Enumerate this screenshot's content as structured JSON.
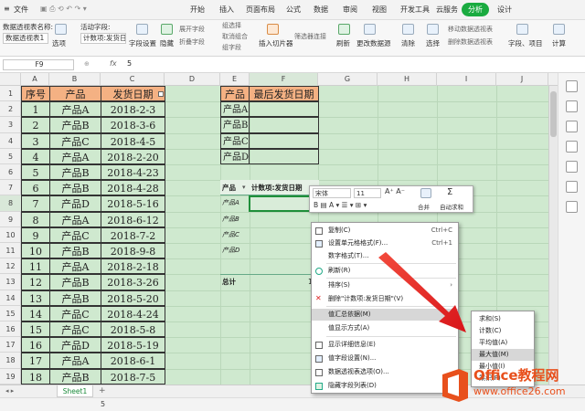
{
  "menubar": {
    "file": "文件",
    "tabs": [
      "开始",
      "插入",
      "页面布局",
      "公式",
      "数据",
      "审阅",
      "视图",
      "开发工具",
      "云服务",
      "分析",
      "设计"
    ],
    "active_tab": "分析"
  },
  "ribbon": {
    "pivot_name_label": "数据透视表名称:",
    "pivot_name_value": "数据透视表1",
    "options_label": "选项",
    "active_field_label": "活动字段:",
    "active_field_value": "计数项:发货日期",
    "field_settings": "字段设置",
    "hide": "隐藏",
    "expand_field": "展开字段",
    "collapse_field": "折叠字段",
    "group_select": "组选择",
    "ungroup": "取消组合",
    "group_field": "组字段",
    "insert_slicer": "插入切片器",
    "filter_conn": "筛选器连接",
    "refresh": "刷新",
    "change_source": "更改数据源",
    "clear": "清除",
    "select": "选择",
    "move_pivot": "移动数据透视表",
    "delete_pivot": "删除数据透视表",
    "fields_items": "字段、项目",
    "calc": "计算"
  },
  "formula_bar": {
    "name_box": "F9",
    "fx": "fx",
    "value": "5"
  },
  "columns": [
    "A",
    "B",
    "C",
    "D",
    "E",
    "F",
    "G",
    "H",
    "I",
    "J"
  ],
  "rows": [
    "1",
    "2",
    "3",
    "4",
    "5",
    "6",
    "7",
    "8",
    "9",
    "10",
    "11",
    "12",
    "13",
    "14",
    "15",
    "16",
    "17",
    "18",
    "19"
  ],
  "table": {
    "headers": [
      "序号",
      "产品",
      "发货日期"
    ],
    "data": [
      [
        "1",
        "产品A",
        "2018-2-3"
      ],
      [
        "2",
        "产品B",
        "2018-3-6"
      ],
      [
        "3",
        "产品C",
        "2018-4-5"
      ],
      [
        "4",
        "产品A",
        "2018-2-20"
      ],
      [
        "5",
        "产品B",
        "2018-4-23"
      ],
      [
        "6",
        "产品B",
        "2018-4-28"
      ],
      [
        "7",
        "产品D",
        "2018-5-16"
      ],
      [
        "8",
        "产品A",
        "2018-6-12"
      ],
      [
        "9",
        "产品C",
        "2018-7-2"
      ],
      [
        "10",
        "产品B",
        "2018-9-8"
      ],
      [
        "11",
        "产品A",
        "2018-2-18"
      ],
      [
        "12",
        "产品B",
        "2018-3-26"
      ],
      [
        "13",
        "产品B",
        "2018-5-20"
      ],
      [
        "14",
        "产品C",
        "2018-4-24"
      ],
      [
        "15",
        "产品C",
        "2018-5-8"
      ],
      [
        "16",
        "产品D",
        "2018-5-19"
      ],
      [
        "17",
        "产品A",
        "2018-6-1"
      ],
      [
        "18",
        "产品B",
        "2018-7-5"
      ]
    ]
  },
  "summary": {
    "headers": [
      "产品",
      "最后发货日期"
    ],
    "items": [
      "产品A",
      "产品B",
      "产品C",
      "产品D"
    ]
  },
  "pivot": {
    "row_label": "产品",
    "value_label": "计数项:发货日期",
    "items": [
      "产品A",
      "产品B",
      "产品C",
      "产品D"
    ],
    "first_value": "5",
    "total_label": "总计",
    "total_value": "1"
  },
  "mini_toolbar": {
    "font": "宋体",
    "size": "11",
    "merge": "合并",
    "autosum": "自动求和"
  },
  "context_menu": {
    "items": [
      {
        "label": "复制(C)",
        "shortcut": "Ctrl+C"
      },
      {
        "label": "设置单元格格式(F)...",
        "shortcut": "Ctrl+1"
      },
      {
        "label": "数字格式(T)...",
        "shortcut": ""
      },
      {
        "label": "刷新(R)",
        "shortcut": ""
      },
      {
        "label": "排序(S)",
        "shortcut": ""
      },
      {
        "label": "删除\"计数项:发货日期\"(V)",
        "shortcut": ""
      },
      {
        "label": "值汇总依据(M)",
        "shortcut": ""
      },
      {
        "label": "值显示方式(A)",
        "shortcut": ""
      },
      {
        "label": "显示详细信息(E)",
        "shortcut": ""
      },
      {
        "label": "值字段设置(N)...",
        "shortcut": ""
      },
      {
        "label": "数据透视表选项(O)...",
        "shortcut": ""
      },
      {
        "label": "隐藏字段列表(D)",
        "shortcut": ""
      }
    ]
  },
  "submenu": {
    "items": [
      "求和(S)",
      "计数(C)",
      "平均值(A)",
      "最大值(M)",
      "最小值(I)",
      "乘积(P)"
    ]
  },
  "sheet_tab": "Sheet1",
  "status": {
    "value": "5"
  },
  "watermark": {
    "line1": "Office教程网",
    "line2": "www.office26.com"
  },
  "colors": {
    "accent": "#1aab40",
    "header_fill": "#f4b183",
    "sheet_fill": "#cfe9cf",
    "arrow": "#e8231f"
  }
}
